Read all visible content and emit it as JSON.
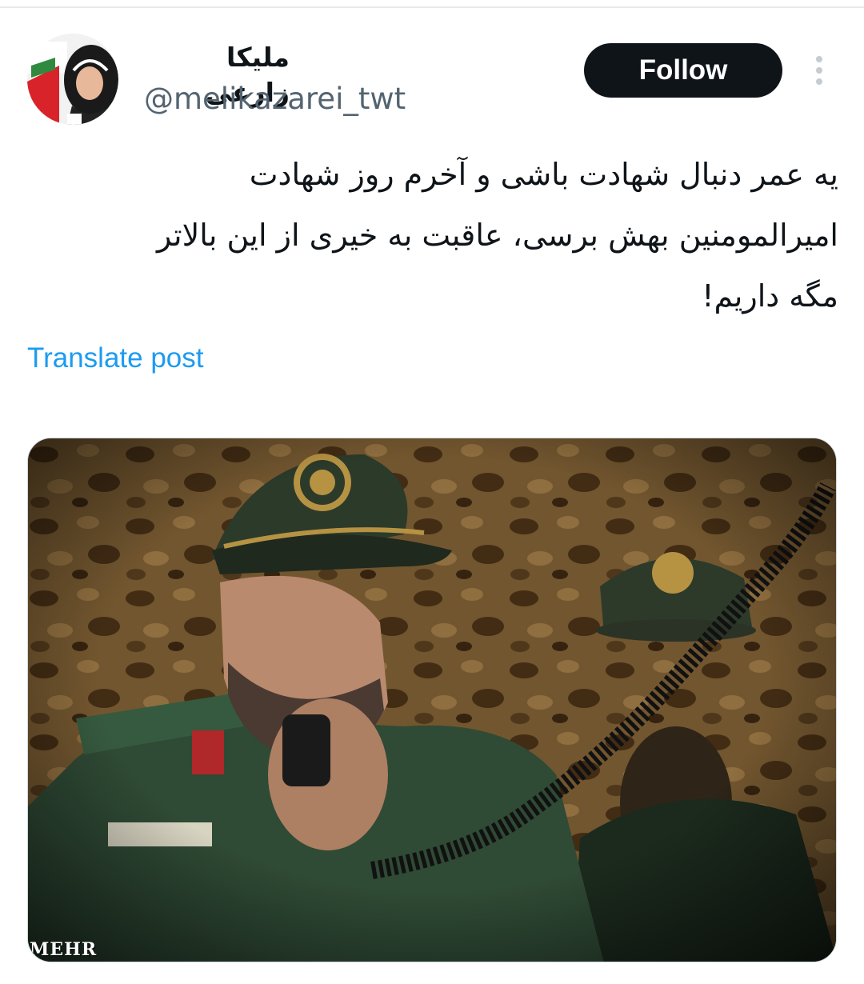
{
  "post": {
    "author": {
      "display_name": "ملیکا زارعی",
      "handle": "@melikazarei_twt",
      "avatar_icon": "profile-photo"
    },
    "follow_label": "Follow",
    "more_icon": "more-vertical-icon",
    "text": "یه عمر دنبال شهادت باشی و آخرم روز شهادت\nامیرالمومنین بهش برسی، عاقبت به خیری از این بالاتر\nمگه داریم!",
    "translate_label": "Translate post",
    "media": {
      "watermark": "MEHR"
    }
  },
  "colors": {
    "text_primary": "#0f1419",
    "text_secondary": "#536471",
    "link": "#1d9bf0",
    "follow_bg": "#0f1419"
  }
}
